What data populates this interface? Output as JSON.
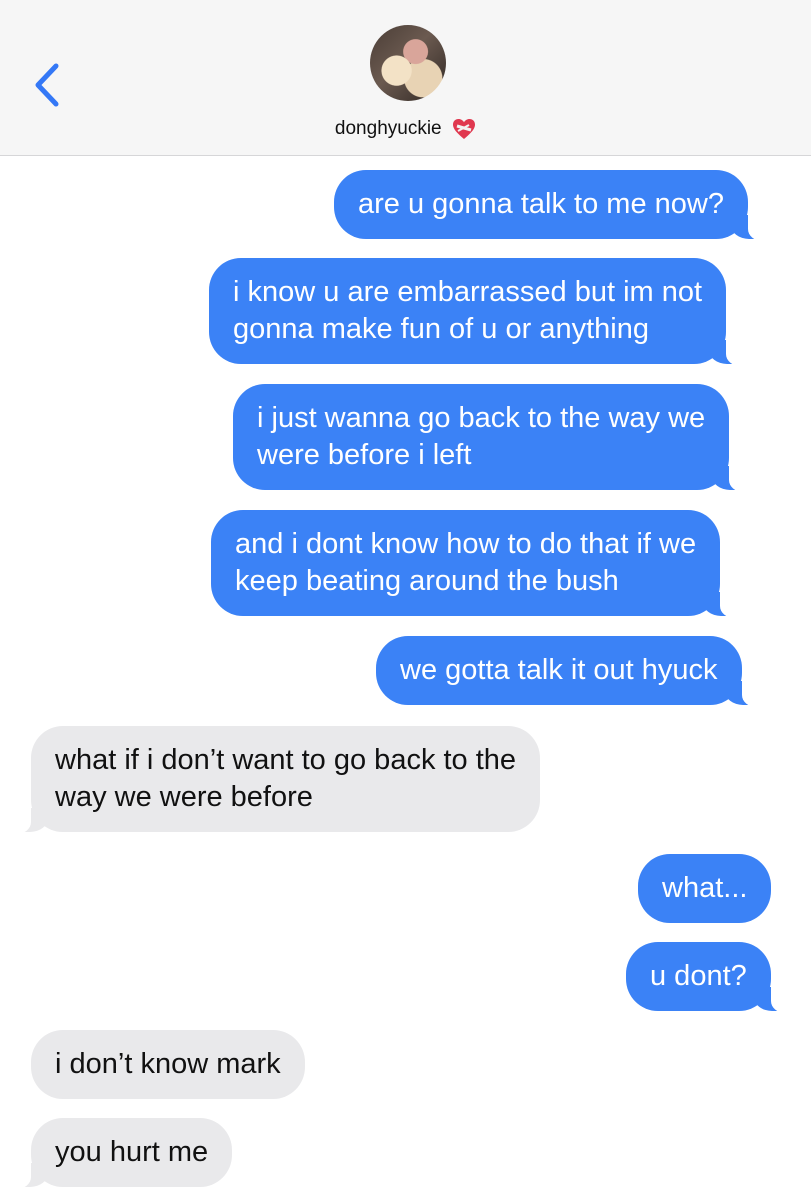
{
  "header": {
    "contact_name": "donghyuckie"
  },
  "icons": {
    "back": "chevron-left-icon",
    "contact_badge": "mending-heart-icon"
  },
  "colors": {
    "sent_bubble": "#3b82f6",
    "received_bubble": "#e9e9eb",
    "accent": "#3478f6"
  },
  "messages": [
    {
      "direction": "sent",
      "lines": [
        "are u gonna talk to me now?"
      ]
    },
    {
      "direction": "sent",
      "lines": [
        "i know u are embarrassed but im not",
        "gonna make fun of u or anything"
      ]
    },
    {
      "direction": "sent",
      "lines": [
        "i just wanna go back to the way we",
        "were before i left"
      ]
    },
    {
      "direction": "sent",
      "lines": [
        "and i dont know how to do that if we",
        "keep beating around the bush"
      ]
    },
    {
      "direction": "sent",
      "lines": [
        "we gotta talk it out hyuck"
      ]
    },
    {
      "direction": "received",
      "lines": [
        "what if i don’t want to go back to the",
        "way we were before"
      ]
    },
    {
      "direction": "sent",
      "lines": [
        "what..."
      ]
    },
    {
      "direction": "sent",
      "lines": [
        "u dont?"
      ]
    },
    {
      "direction": "received",
      "lines": [
        "i don’t know mark"
      ]
    },
    {
      "direction": "received",
      "lines": [
        "you hurt me"
      ]
    }
  ]
}
